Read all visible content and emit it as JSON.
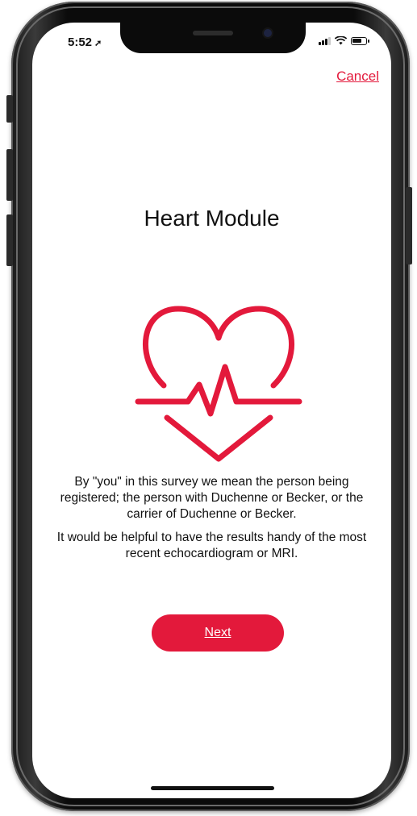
{
  "status_bar": {
    "time": "5:52",
    "location_arrow": "➚"
  },
  "header": {
    "cancel_label": "Cancel"
  },
  "main": {
    "title": "Heart Module",
    "icon": "heart-rate-icon",
    "paragraphs": [
      "By \"you\" in this survey we mean the person being registered; the person with Duchenne or Becker, or the carrier of Duchenne or Becker.",
      "It would be helpful to have the results handy of the most recent echocardiogram or MRI."
    ],
    "next_label": "Next"
  },
  "colors": {
    "accent": "#e3193b",
    "text": "#111111",
    "background": "#ffffff"
  }
}
